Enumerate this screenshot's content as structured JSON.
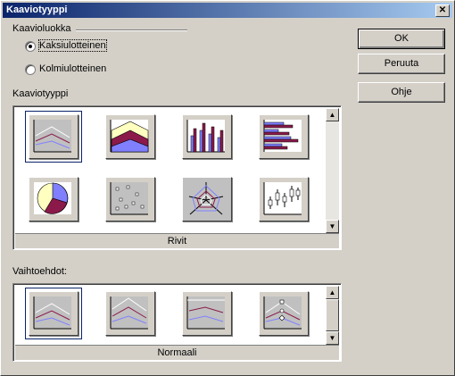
{
  "window": {
    "title": "Kaaviotyyppi",
    "close_symbol": "✕"
  },
  "chart_class": {
    "label": "Kaavioluokka",
    "options": [
      {
        "label": "Kaksiulotteinen",
        "checked": true
      },
      {
        "label": "Kolmiulotteinen",
        "checked": false
      }
    ]
  },
  "buttons": {
    "ok": "OK",
    "cancel": "Peruuta",
    "help": "Ohje"
  },
  "chart_type": {
    "label": "Kaaviotyyppi",
    "caption": "Rivit",
    "items": [
      "line-chart-icon",
      "area-chart-icon",
      "column-chart-icon",
      "bar-chart-icon",
      "pie-chart-icon",
      "scatter-chart-icon",
      "net-chart-icon",
      "stock-chart-icon"
    ],
    "selected_index": 0
  },
  "variants": {
    "label": "Vaihtoehdot:",
    "caption": "Normaali",
    "items": [
      "line-normal-icon",
      "line-stacked-icon",
      "line-percent-icon",
      "line-symbols-icon"
    ],
    "selected_index": 0
  }
}
